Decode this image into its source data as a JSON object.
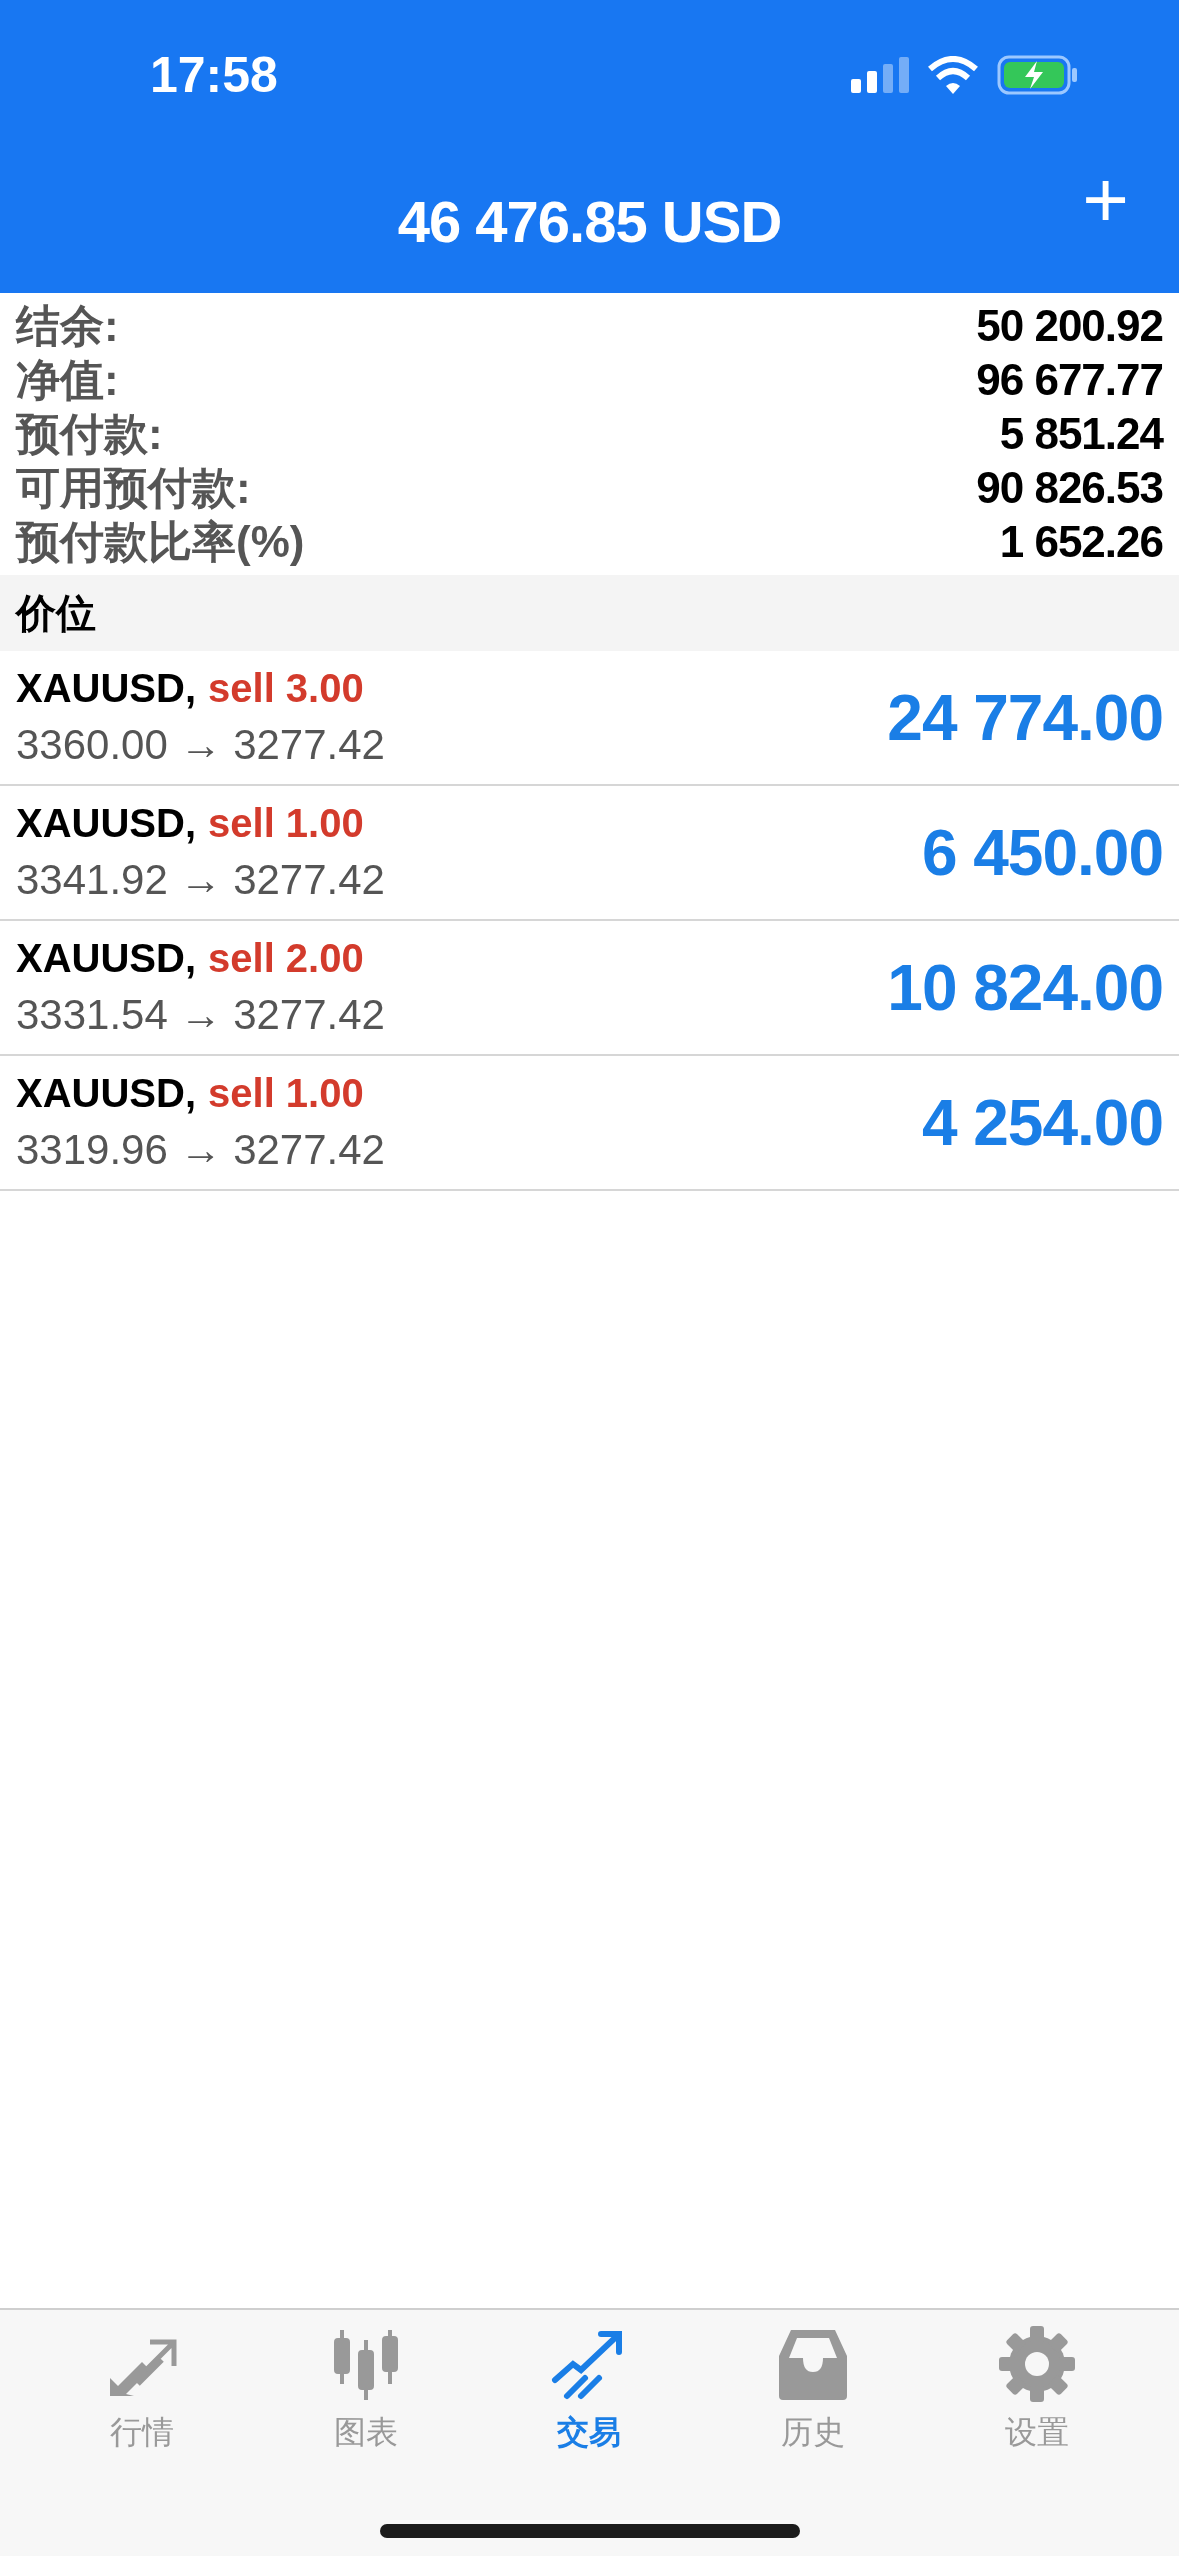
{
  "status_bar": {
    "time": "17:58"
  },
  "header": {
    "title": "46 476.85 USD",
    "add_button": "+"
  },
  "summary": [
    {
      "label": "结余:",
      "value": "50 200.92"
    },
    {
      "label": "净值:",
      "value": "96 677.77"
    },
    {
      "label": "预付款:",
      "value": "5 851.24"
    },
    {
      "label": "可用预付款:",
      "value": "90 826.53"
    },
    {
      "label": "预付款比率(%)",
      "value": "1 652.26"
    }
  ],
  "section_title": "价位",
  "positions": [
    {
      "symbol": "XAUUSD,",
      "order": "sell 3.00",
      "prices": "3360.00 → 3277.42",
      "profit": "24 774.00"
    },
    {
      "symbol": "XAUUSD,",
      "order": "sell 1.00",
      "prices": "3341.92 → 3277.42",
      "profit": "6 450.00"
    },
    {
      "symbol": "XAUUSD,",
      "order": "sell 2.00",
      "prices": "3331.54 → 3277.42",
      "profit": "10 824.00"
    },
    {
      "symbol": "XAUUSD,",
      "order": "sell 1.00",
      "prices": "3319.96 → 3277.42",
      "profit": "4 254.00"
    }
  ],
  "tabs": [
    {
      "label": "行情",
      "selected": false
    },
    {
      "label": "图表",
      "selected": false
    },
    {
      "label": "交易",
      "selected": true
    },
    {
      "label": "历史",
      "selected": false
    },
    {
      "label": "设置",
      "selected": false
    }
  ]
}
